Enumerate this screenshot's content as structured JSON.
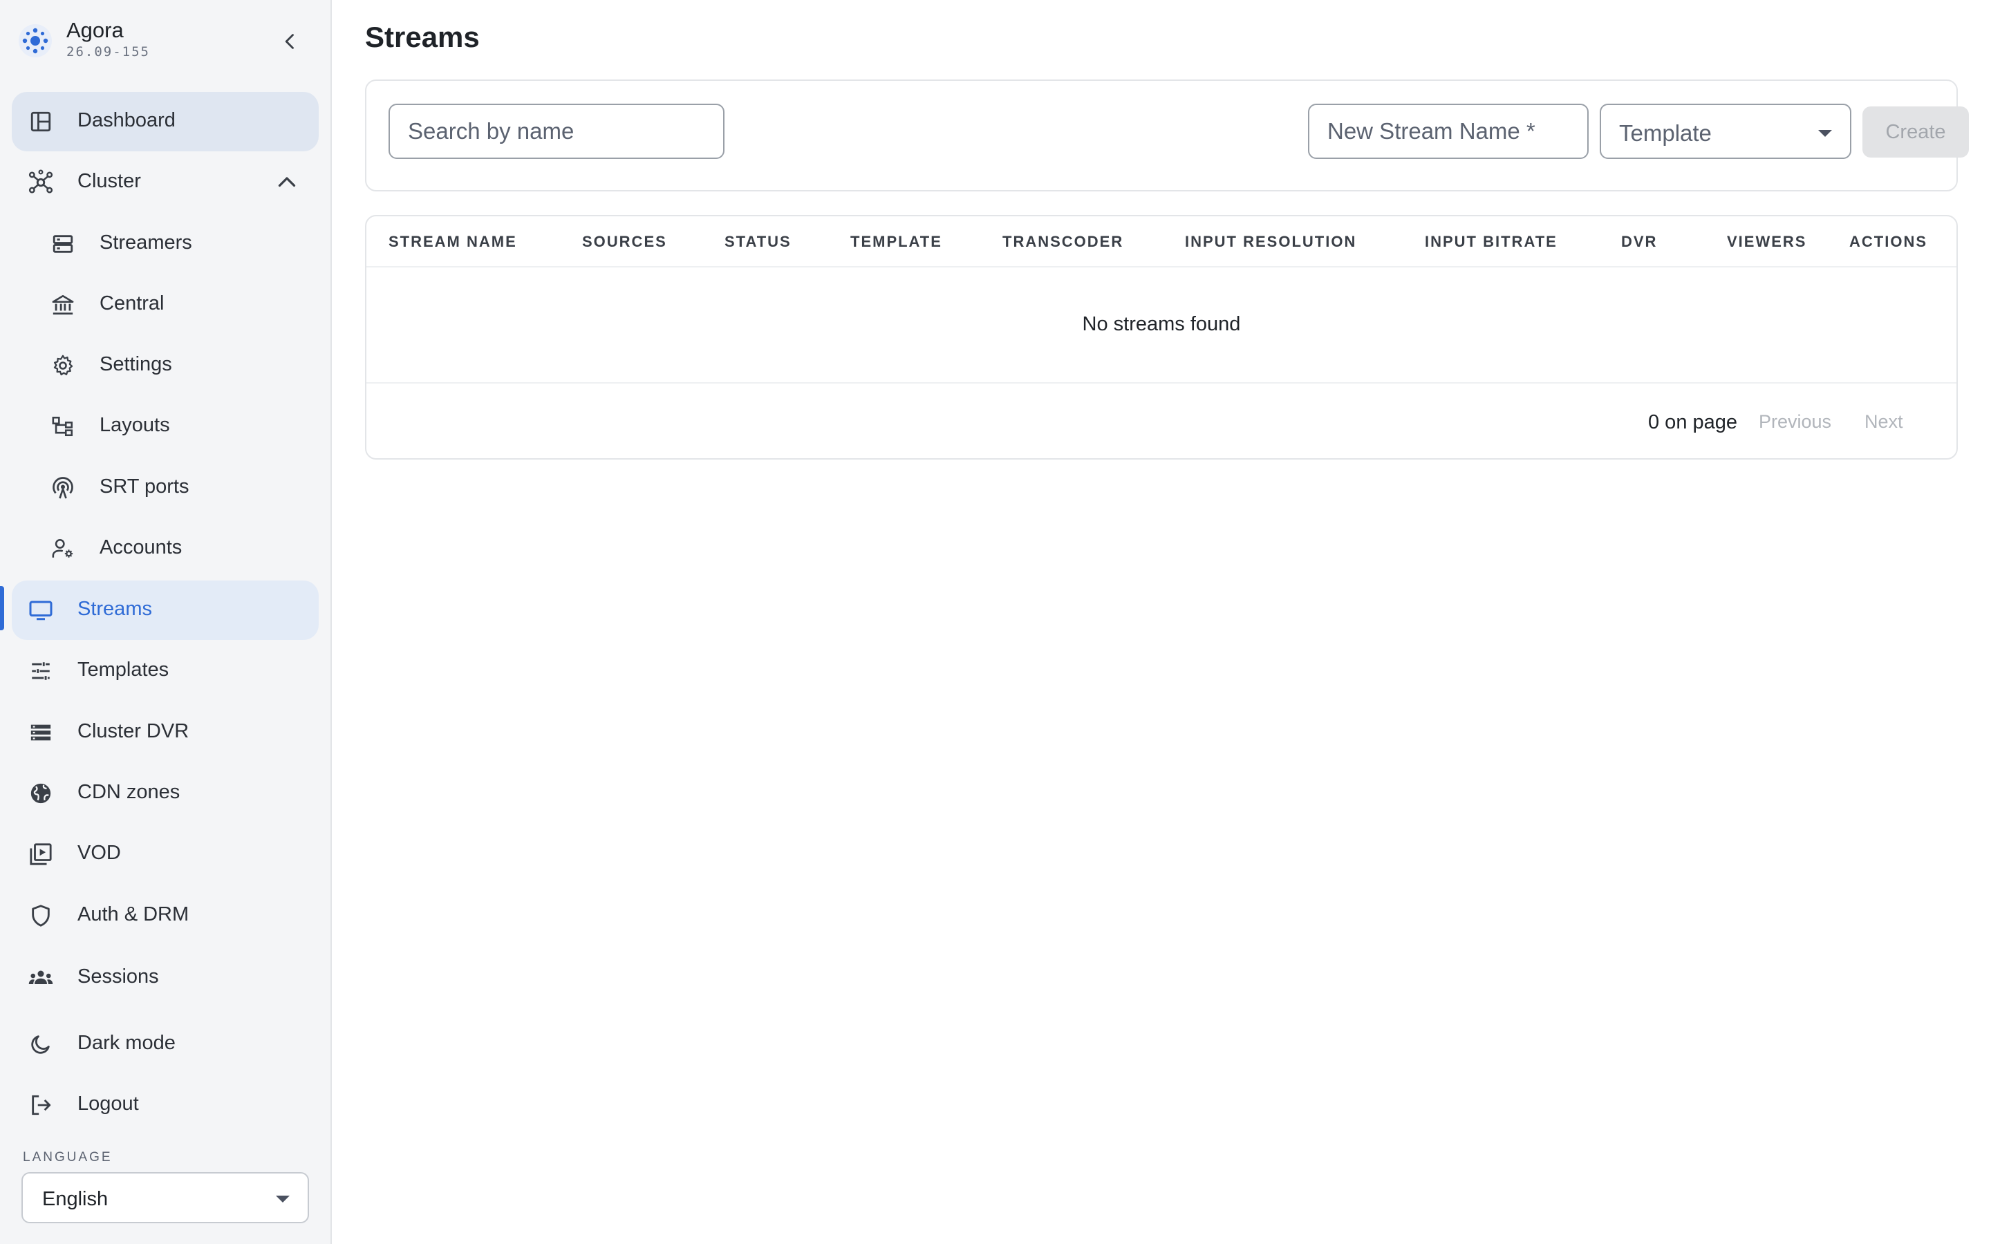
{
  "brand": {
    "name": "Agora",
    "version": "26.09-155"
  },
  "nav": {
    "dashboard": "Dashboard",
    "cluster": "Cluster",
    "cluster_children": {
      "streamers": "Streamers",
      "central": "Central",
      "settings": "Settings",
      "layouts": "Layouts",
      "srt_ports": "SRT ports",
      "accounts": "Accounts"
    },
    "streams": "Streams",
    "templates": "Templates",
    "cluster_dvr": "Cluster DVR",
    "cdn_zones": "CDN zones",
    "vod": "VOD",
    "auth_drm": "Auth & DRM",
    "sessions": "Sessions",
    "dark_mode": "Dark mode",
    "logout": "Logout",
    "selected": "Streams"
  },
  "language": {
    "label": "LANGUAGE",
    "value": "English"
  },
  "page": {
    "title": "Streams"
  },
  "toolbar": {
    "search_placeholder": "Search by name",
    "new_stream_placeholder": "New Stream Name *",
    "template_placeholder": "Template",
    "create_label": "Create"
  },
  "table": {
    "columns": [
      "STREAM NAME",
      "SOURCES",
      "STATUS",
      "TEMPLATE",
      "TRANSCODER",
      "INPUT RESOLUTION",
      "INPUT BITRATE",
      "DVR",
      "VIEWERS",
      "ACTIONS"
    ],
    "empty_message": "No streams found"
  },
  "pagination": {
    "count": "0 on page",
    "previous": "Previous",
    "next": "Next"
  },
  "colors": {
    "accent": "#2f6bd6",
    "sidebar_bg": "#f4f5f7",
    "selected_bg": "#e3ebf7"
  }
}
